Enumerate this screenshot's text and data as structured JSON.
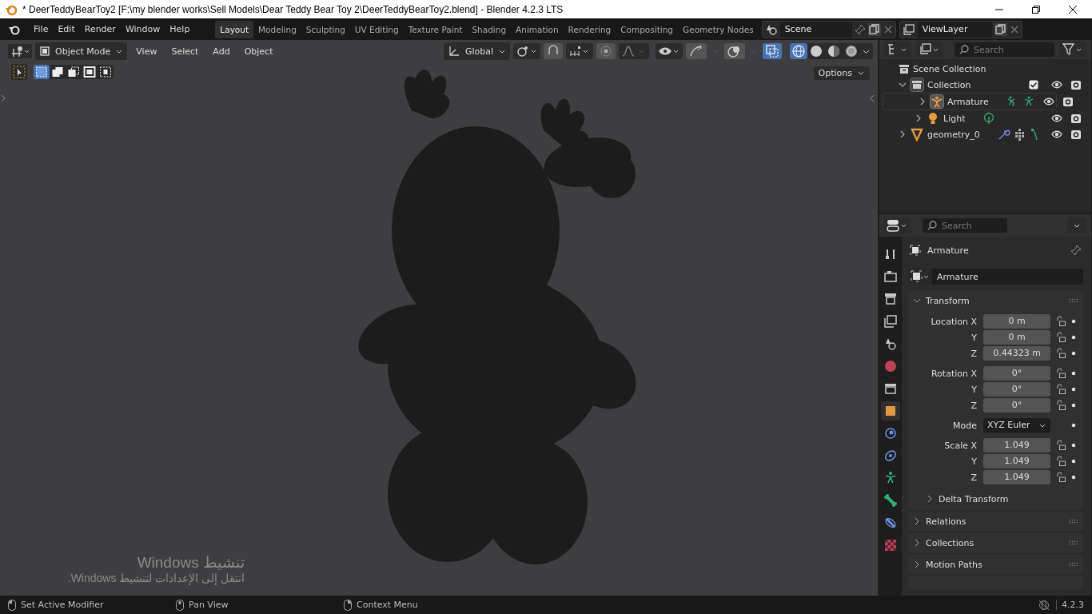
{
  "title_bar": {
    "title": "* DeerTeddyBearToy2 [F:\\my blender works\\Sell Models\\Dear Teddy Bear Toy 2\\DeerTeddyBearToy2.blend] - Blender 4.2.3 LTS"
  },
  "menu": [
    "File",
    "Edit",
    "Render",
    "Window",
    "Help"
  ],
  "workspaces": [
    {
      "label": "Layout",
      "selected": true
    },
    {
      "label": "Modeling",
      "selected": false
    },
    {
      "label": "Sculpting",
      "selected": false
    },
    {
      "label": "UV Editing",
      "selected": false
    },
    {
      "label": "Texture Paint",
      "selected": false
    },
    {
      "label": "Shading",
      "selected": false
    },
    {
      "label": "Animation",
      "selected": false
    },
    {
      "label": "Rendering",
      "selected": false
    },
    {
      "label": "Compositing",
      "selected": false
    },
    {
      "label": "Geometry Nodes",
      "selected": false
    }
  ],
  "scene": {
    "name": "Scene"
  },
  "view_layer": {
    "name": "ViewLayer"
  },
  "viewport": {
    "mode": "Object Mode",
    "menus": [
      "View",
      "Select",
      "Add",
      "Object"
    ],
    "orientation": "Global",
    "options": "Options",
    "select_modes": [
      {
        "selected": true
      },
      {
        "selected": false
      },
      {
        "selected": false
      },
      {
        "selected": false
      },
      {
        "selected": false
      }
    ],
    "shading": [
      {
        "kind": "wireframe",
        "selected": true
      },
      {
        "kind": "solid",
        "selected": false
      },
      {
        "kind": "material",
        "selected": false
      },
      {
        "kind": "rendered",
        "selected": false
      }
    ]
  },
  "outliner": {
    "search": {
      "placeholder": "Search"
    },
    "root": "Scene Collection",
    "tree": [
      {
        "label": "Collection",
        "kind": "collection",
        "expanded": true,
        "checked": true,
        "children": [
          {
            "label": "Armature",
            "kind": "armature",
            "selected": true,
            "expanded": false
          },
          {
            "label": "Light",
            "kind": "light",
            "selected": false,
            "expanded": false
          }
        ]
      },
      {
        "label": "geometry_0",
        "kind": "mesh",
        "selected": false,
        "expanded": false
      }
    ]
  },
  "properties": {
    "search": {
      "placeholder": "Search"
    },
    "object_name": "Armature",
    "data_name": "Armature",
    "tabs": [
      {
        "kind": "tool",
        "selected": false
      },
      {
        "kind": "render",
        "selected": false
      },
      {
        "kind": "output",
        "selected": false
      },
      {
        "kind": "view_layer",
        "selected": false
      },
      {
        "kind": "scene",
        "selected": false
      },
      {
        "kind": "world",
        "selected": false
      },
      {
        "kind": "collection",
        "selected": false
      },
      {
        "kind": "object",
        "selected": true
      },
      {
        "kind": "physics",
        "selected": false
      },
      {
        "kind": "constraints",
        "selected": false
      },
      {
        "kind": "data",
        "selected": false
      },
      {
        "kind": "bone",
        "selected": false
      },
      {
        "kind": "bone_constraints",
        "selected": false
      },
      {
        "kind": "texture",
        "selected": false
      }
    ],
    "transform": {
      "title": "Transform",
      "expanded": true,
      "rows": [
        {
          "kind": "number",
          "label": "Location X",
          "value": "0 m"
        },
        {
          "kind": "number",
          "label": "Y",
          "value": "0 m"
        },
        {
          "kind": "number",
          "label": "Z",
          "value": "0.44323 m"
        },
        {
          "kind": "number",
          "label": "Rotation X",
          "value": "0°"
        },
        {
          "kind": "number",
          "label": "Y",
          "value": "0°"
        },
        {
          "kind": "number",
          "label": "Z",
          "value": "0°"
        },
        {
          "kind": "dropdown",
          "label": "Mode",
          "value": "XYZ Euler"
        },
        {
          "kind": "number",
          "label": "Scale X",
          "value": "1.049"
        },
        {
          "kind": "number",
          "label": "Y",
          "value": "1.049"
        },
        {
          "kind": "number",
          "label": "Z",
          "value": "1.049"
        }
      ],
      "subpanel": {
        "label": "Delta Transform",
        "expanded": false
      }
    },
    "panels": [
      {
        "label": "Relations",
        "expanded": false
      },
      {
        "label": "Collections",
        "expanded": false
      },
      {
        "label": "Motion Paths",
        "expanded": false
      }
    ]
  },
  "os_notice": {
    "title": "تنشيط Windows",
    "text": "انتقل إلى الإعدادات لتنشيط Windows."
  },
  "status_bar": {
    "hints": [
      {
        "kind": "left",
        "label": "Set Active Modifier"
      },
      {
        "kind": "middle",
        "label": "Pan View"
      },
      {
        "kind": "right",
        "label": "Context Menu"
      }
    ],
    "version": "4.2.3"
  }
}
